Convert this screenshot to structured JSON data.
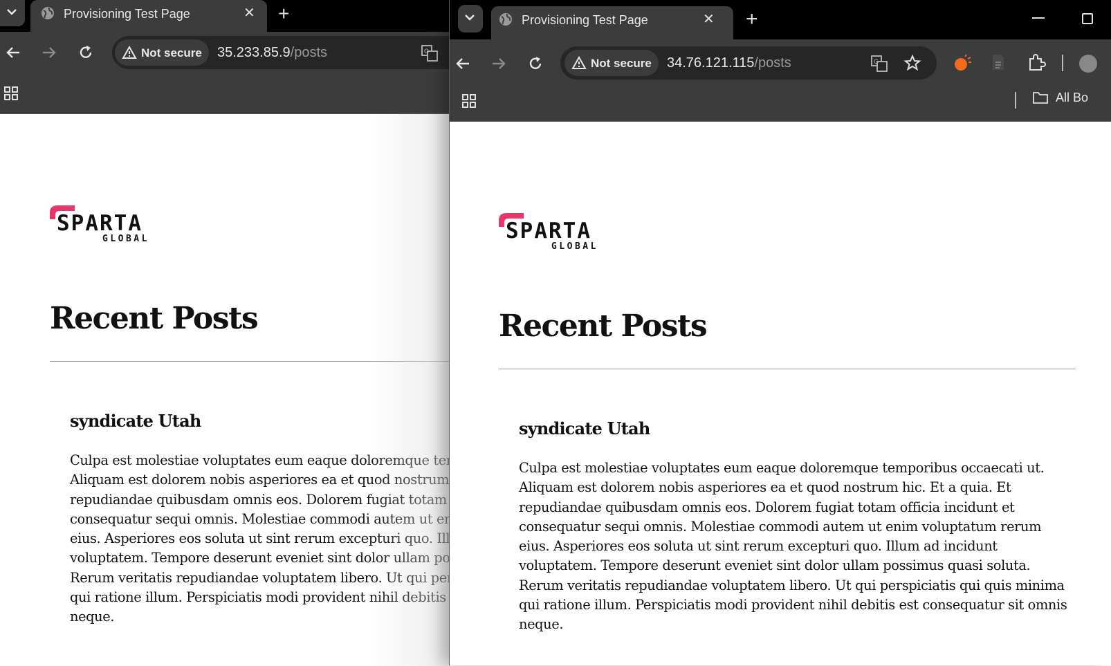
{
  "left_window": {
    "tab_title": "Provisioning Test Page",
    "security_label": "Not secure",
    "url_host": "35.233.85.9",
    "url_path": "/posts"
  },
  "right_window": {
    "tab_title": "Provisioning Test Page",
    "security_label": "Not secure",
    "url_host": "34.76.121.115",
    "url_path": "/posts",
    "bookmarks_label": "All Bo"
  },
  "page": {
    "logo_main": "SPARTA",
    "logo_sub": "GLOBAL",
    "heading": "Recent Posts",
    "post_title": "syndicate Utah",
    "post_body_lines_right": [
      "Culpa est molestiae voluptates eum eaque doloremque temporibus occaecati ut.",
      "Aliquam est dolorem nobis asperiores ea et quod nostrum hic. Et a quia. Et",
      "repudiandae quibusdam omnis eos. Dolorem fugiat totam officia incidunt et",
      "consequatur sequi omnis. Molestiae commodi autem ut enim voluptatum rerum",
      "eius. Asperiores eos soluta ut sint rerum excepturi quo. Illum ad incidunt",
      "voluptatem. Tempore deserunt eveniet sint dolor ullam possimus quasi soluta.",
      "Rerum veritatis repudiandae voluptatem libero. Ut qui perspiciatis qui quis minima",
      "qui ratione illum. Perspiciatis modi provident nihil debitis est consequatur sit omnis",
      "neque."
    ]
  },
  "colors": {
    "tab_bg": "#3c3c3c",
    "tabstrip_bg": "#000000",
    "omnibox_bg": "#262626",
    "logo_accent": "#e8366b"
  },
  "icons": [
    "chevron-down-icon",
    "globe-icon",
    "close-icon",
    "plus-icon",
    "back-icon",
    "forward-icon",
    "reload-icon",
    "warning-icon",
    "translate-icon",
    "star-icon",
    "extension-icon",
    "puzzle-icon",
    "apps-grid-icon",
    "folder-icon",
    "minimize-icon",
    "maximize-icon"
  ]
}
